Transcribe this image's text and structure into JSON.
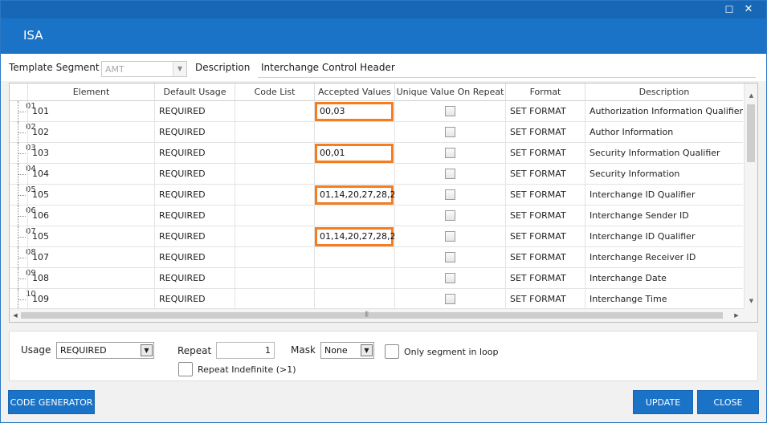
{
  "window": {
    "title": "ISA",
    "maximize_icon": "maximize-icon",
    "close_icon": "close-icon"
  },
  "segment": {
    "template_label": "Template Segment",
    "template_value": "AMT",
    "description_label": "Description",
    "description_value": "Interchange Control Header"
  },
  "grid": {
    "columns": [
      "Element",
      "Default Usage",
      "Code List",
      "Accepted Values",
      "Unique Value On Repeat",
      "Format",
      "Description"
    ],
    "rows": [
      {
        "num": "01",
        "element": "101",
        "usage": "REQUIRED",
        "codelist": "",
        "accepted": "00,03",
        "unique": false,
        "format": "SET FORMAT",
        "description": "Authorization Information Qualifier",
        "highlight": true
      },
      {
        "num": "02",
        "element": "102",
        "usage": "REQUIRED",
        "codelist": "",
        "accepted": "",
        "unique": false,
        "format": "SET FORMAT",
        "description": "Author Information",
        "highlight": false
      },
      {
        "num": "03",
        "element": "103",
        "usage": "REQUIRED",
        "codelist": "",
        "accepted": "00,01",
        "unique": false,
        "format": "SET FORMAT",
        "description": "Security Information Qualifier",
        "highlight": true
      },
      {
        "num": "04",
        "element": "104",
        "usage": "REQUIRED",
        "codelist": "",
        "accepted": "",
        "unique": false,
        "format": "SET FORMAT",
        "description": "Security Information",
        "highlight": false
      },
      {
        "num": "05",
        "element": "105",
        "usage": "REQUIRED",
        "codelist": "",
        "accepted": "01,14,20,27,28,2",
        "unique": false,
        "format": "SET FORMAT",
        "description": "Interchange ID Qualifier",
        "highlight": true
      },
      {
        "num": "06",
        "element": "106",
        "usage": "REQUIRED",
        "codelist": "",
        "accepted": "",
        "unique": false,
        "format": "SET FORMAT",
        "description": "Interchange Sender ID",
        "highlight": false
      },
      {
        "num": "07",
        "element": "105",
        "usage": "REQUIRED",
        "codelist": "",
        "accepted": "01,14,20,27,28,2",
        "unique": false,
        "format": "SET FORMAT",
        "description": "Interchange ID Qualifier",
        "highlight": true
      },
      {
        "num": "08",
        "element": "107",
        "usage": "REQUIRED",
        "codelist": "",
        "accepted": "",
        "unique": false,
        "format": "SET FORMAT",
        "description": "Interchange Receiver ID",
        "highlight": false
      },
      {
        "num": "09",
        "element": "108",
        "usage": "REQUIRED",
        "codelist": "",
        "accepted": "",
        "unique": false,
        "format": "SET FORMAT",
        "description": "Interchange Date",
        "highlight": false
      },
      {
        "num": "10",
        "element": "109",
        "usage": "REQUIRED",
        "codelist": "",
        "accepted": "",
        "unique": false,
        "format": "SET FORMAT",
        "description": "Interchange Time",
        "highlight": false
      }
    ]
  },
  "options": {
    "usage_label": "Usage",
    "usage_value": "REQUIRED",
    "repeat_label": "Repeat",
    "repeat_value": "1",
    "mask_label": "Mask",
    "mask_value": "None",
    "only_segment_label": "Only segment in loop",
    "repeat_indefinite_label": "Repeat Indefinite (>1)"
  },
  "buttons": {
    "code_generator": "CODE GENERATOR",
    "update": "UPDATE",
    "close": "CLOSE"
  },
  "colors": {
    "accent": "#1a73c6",
    "highlight": "#f57c1f"
  }
}
